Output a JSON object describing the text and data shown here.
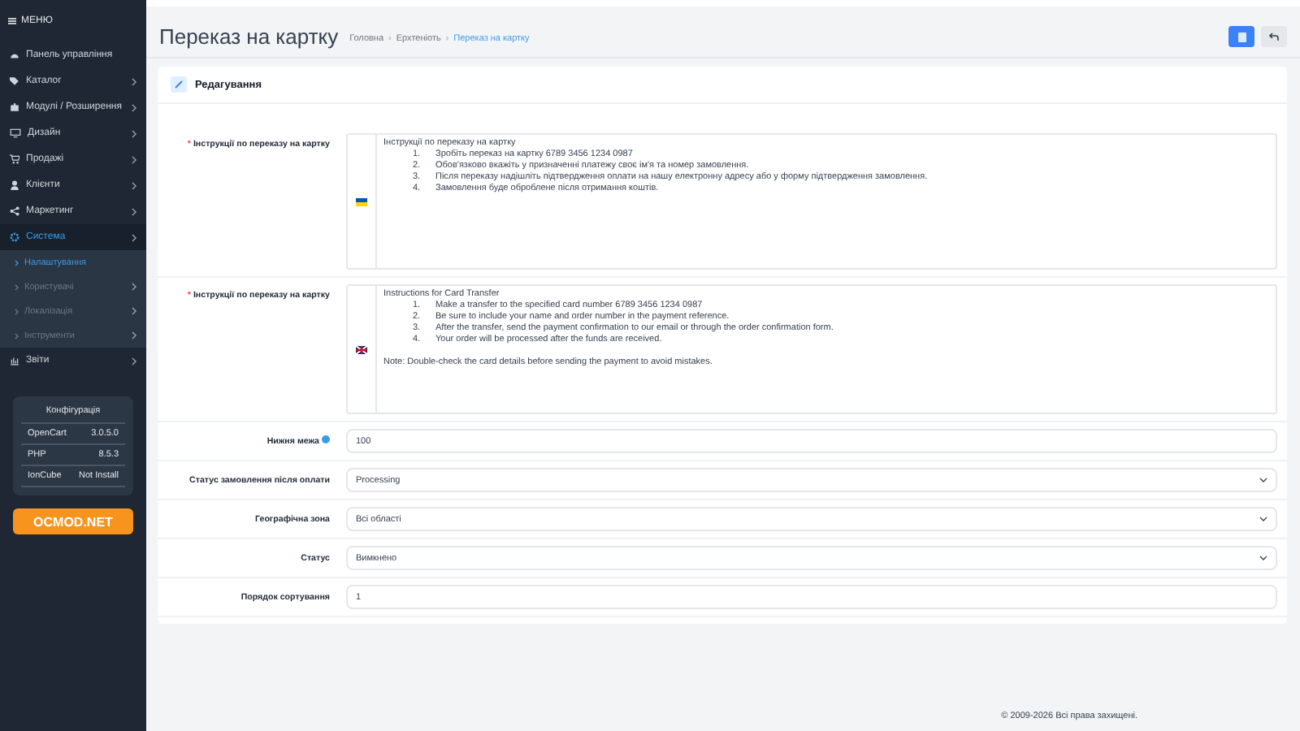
{
  "sidebar": {
    "menu_title": "МЕНЮ",
    "items": [
      {
        "label": "Панель управління",
        "has_arrow": false,
        "selected": false
      },
      {
        "label": "Каталог",
        "has_arrow": true,
        "selected": false
      },
      {
        "label": "Модулі / Розширення",
        "has_arrow": true,
        "selected": false
      },
      {
        "label": "Дизайн",
        "has_arrow": true,
        "selected": false
      },
      {
        "label": "Продажі",
        "has_arrow": true,
        "selected": false
      },
      {
        "label": "Клієнти",
        "has_arrow": true,
        "selected": false
      },
      {
        "label": "Маркетинг",
        "has_arrow": true,
        "selected": false
      },
      {
        "label": "Система",
        "has_arrow": true,
        "selected": true,
        "children": [
          {
            "label": "Налаштування",
            "has_arrow": false,
            "selected": true
          },
          {
            "label": "Користувачі",
            "has_arrow": true,
            "selected": false
          },
          {
            "label": "Локалізація",
            "has_arrow": true,
            "selected": false
          },
          {
            "label": "Інструменти",
            "has_arrow": true,
            "selected": false
          }
        ]
      },
      {
        "label": "Звіти",
        "has_arrow": true,
        "selected": false
      }
    ],
    "config": {
      "title": "Конфігурація",
      "rows": [
        {
          "name": "OpenCart",
          "value": "3.0.5.0"
        },
        {
          "name": "PHP",
          "value": "8.5.3"
        },
        {
          "name": "IonCube",
          "value": "Not Install"
        }
      ]
    },
    "brand_button": "OCMOD.NET"
  },
  "page": {
    "title": "Переказ на картку",
    "separator": "›",
    "breadcrumb": [
      {
        "label": "Головна",
        "current": false
      },
      {
        "label": "Ерхтеніоть",
        "current": false
      },
      {
        "label": "Переказ на картку",
        "current": true
      }
    ]
  },
  "card": {
    "title": "Редагування",
    "required_mark": "*",
    "fields": [
      {
        "kind": "textarea",
        "label": "Інструкції по переказу на картку",
        "required": true,
        "help": false,
        "flag": {
          "kind": "ua"
        },
        "heading": "Інструкції по переказу на картку",
        "steps": [
          {
            "number": "1.",
            "text": "Зробіть переказ на картку 6789 3456 1234 0987"
          },
          {
            "number": "2.",
            "text": "Обов'язково вкажіть у призначенні платежу своє ім'я та номер замовлення."
          },
          {
            "number": "3.",
            "text": "Після переказу надішліть підтвердження оплати на нашу електронну адресу або у форму підтвердження замовлення."
          },
          {
            "number": "4.",
            "text": "Замовлення буде оброблене після отримання коштів."
          }
        ]
      },
      {
        "kind": "textarea",
        "label": "Інструкції по переказу на картку",
        "required": true,
        "help": false,
        "flag": {
          "kind": "gb"
        },
        "heading": "Instructions for Card Transfer",
        "steps": [
          {
            "number": "1.",
            "text": "Make a transfer to the specified card number 6789 3456 1234 0987"
          },
          {
            "number": "2.",
            "text": "Be sure to include your name and order number in the payment reference."
          },
          {
            "number": "3.",
            "text": "After the transfer, send the payment confirmation to our email or through the order confirmation form."
          },
          {
            "number": "4.",
            "text": "Your order will be processed after the funds are received."
          }
        ],
        "note": "Note: Double-check the card details before sending the payment to avoid mistakes."
      },
      {
        "kind": "input",
        "label": "Нижня межа",
        "required": false,
        "help": true,
        "value": "100"
      },
      {
        "kind": "select",
        "label": "Статус замовлення після оплати",
        "required": false,
        "help": false,
        "value": "Processing"
      },
      {
        "kind": "select",
        "label": "Географічна зона",
        "required": false,
        "help": false,
        "value": "Всі області"
      },
      {
        "kind": "select",
        "label": "Статус",
        "required": false,
        "help": false,
        "value": "Вимкнено"
      },
      {
        "kind": "input",
        "label": "Порядок сортування",
        "required": false,
        "help": false,
        "value": "1"
      }
    ]
  },
  "footer": "© 2009-2026 Всі права захищені."
}
